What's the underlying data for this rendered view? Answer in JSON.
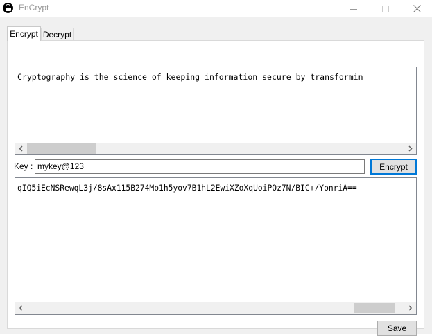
{
  "window": {
    "title": "EnCrypt",
    "icon": "lock-icon"
  },
  "tabs": [
    {
      "label": "Encrypt",
      "active": true
    },
    {
      "label": "Decrypt",
      "active": false
    }
  ],
  "input_text": "Cryptography is the science of keeping information secure by transformin",
  "key": {
    "label": "Key :",
    "value": "mykey@123"
  },
  "encrypt_button": "Encrypt",
  "output_text": "qIQ5iEcNSRewqL3j/8sAx115B274Mo1h5yov7B1hL2EwiXZoXqUoiPOz7N/BIC+/YonriA==",
  "save_button": "Save",
  "colors": {
    "accent": "#0078d7",
    "background": "#f0f0f0"
  }
}
